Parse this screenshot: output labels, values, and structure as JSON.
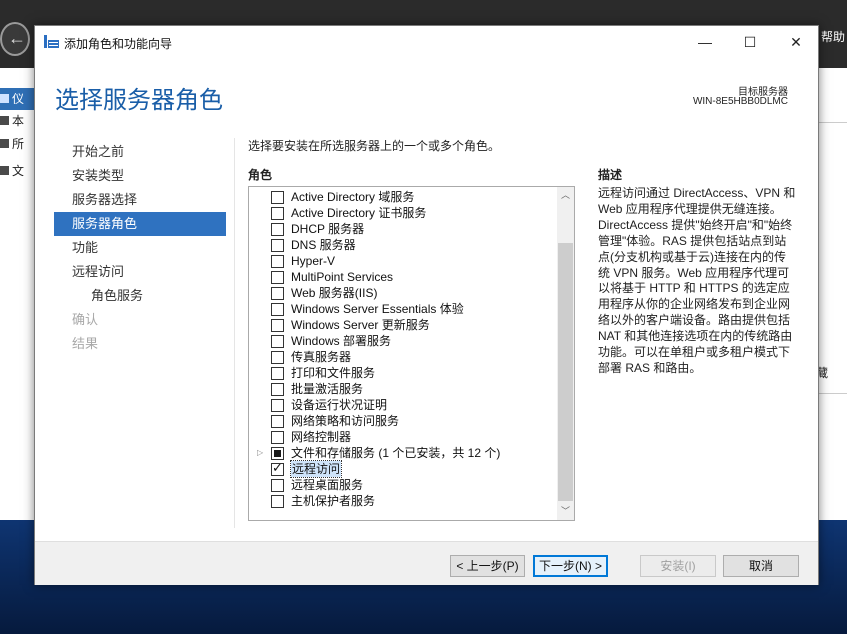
{
  "background_window": {
    "help_label": "帮助",
    "nav_items": [
      {
        "label": "仪",
        "active": true
      },
      {
        "label": "本"
      },
      {
        "label": "所"
      },
      {
        "label": "文"
      }
    ],
    "right_panel_char": "藏"
  },
  "wizard": {
    "title": "添加角色和功能向导",
    "window_controls": {
      "minimize": "—",
      "maximize": "☐",
      "close": "✕"
    },
    "heading": "选择服务器角色",
    "target_server_label": "目标服务器",
    "target_server_name": "WIN-8E5HBB0DLMC",
    "steps": [
      {
        "label": "开始之前",
        "state": "normal"
      },
      {
        "label": "安装类型",
        "state": "normal"
      },
      {
        "label": "服务器选择",
        "state": "normal"
      },
      {
        "label": "服务器角色",
        "state": "active"
      },
      {
        "label": "功能",
        "state": "normal"
      },
      {
        "label": "远程访问",
        "state": "normal"
      },
      {
        "label": "角色服务",
        "state": "sub"
      },
      {
        "label": "确认",
        "state": "disabled"
      },
      {
        "label": "结果",
        "state": "disabled"
      }
    ],
    "instruction": "选择要安装在所选服务器上的一个或多个角色。",
    "roles_header": "角色",
    "roles": [
      {
        "label": "Active Directory 域服务",
        "state": "unchecked"
      },
      {
        "label": "Active Directory 证书服务",
        "state": "unchecked"
      },
      {
        "label": "DHCP 服务器",
        "state": "unchecked"
      },
      {
        "label": "DNS 服务器",
        "state": "unchecked"
      },
      {
        "label": "Hyper-V",
        "state": "unchecked"
      },
      {
        "label": "MultiPoint Services",
        "state": "unchecked"
      },
      {
        "label": "Web 服务器(IIS)",
        "state": "unchecked"
      },
      {
        "label": "Windows Server Essentials 体验",
        "state": "unchecked"
      },
      {
        "label": "Windows Server 更新服务",
        "state": "unchecked"
      },
      {
        "label": "Windows 部署服务",
        "state": "unchecked"
      },
      {
        "label": "传真服务器",
        "state": "unchecked"
      },
      {
        "label": "打印和文件服务",
        "state": "unchecked"
      },
      {
        "label": "批量激活服务",
        "state": "unchecked"
      },
      {
        "label": "设备运行状况证明",
        "state": "unchecked"
      },
      {
        "label": "网络策略和访问服务",
        "state": "unchecked"
      },
      {
        "label": "网络控制器",
        "state": "unchecked"
      },
      {
        "label": "文件和存储服务 (1 个已安装，共 12 个)",
        "state": "partial",
        "expandable": true
      },
      {
        "label": "远程访问",
        "state": "checked",
        "selected": true
      },
      {
        "label": "远程桌面服务",
        "state": "unchecked"
      },
      {
        "label": "主机保护者服务",
        "state": "unchecked"
      }
    ],
    "description_header": "描述",
    "description": "远程访问通过 DirectAccess、VPN 和 Web 应用程序代理提供无缝连接。DirectAccess 提供\"始终开启\"和\"始终管理\"体验。RAS 提供包括站点到站点(分支机构或基于云)连接在内的传统 VPN 服务。Web 应用程序代理可以将基于 HTTP 和 HTTPS 的选定应用程序从你的企业网络发布到企业网络以外的客户端设备。路由提供包括 NAT 和其他连接选项在内的传统路由功能。可以在单租户或多租户模式下部署 RAS 和路由。",
    "buttons": {
      "previous": "< 上一步(P)",
      "next": "下一步(N) >",
      "install": "安装(I)",
      "cancel": "取消"
    },
    "colors": {
      "heading": "#1a5ea8",
      "active_step": "#2f72c0",
      "selection": "#cfe4fa"
    }
  }
}
